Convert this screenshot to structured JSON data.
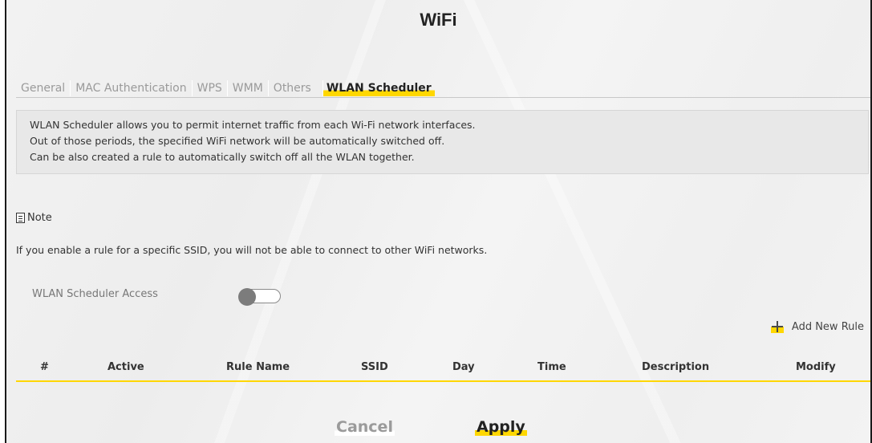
{
  "header": {
    "title": "WiFi"
  },
  "tabs": [
    {
      "label": "General"
    },
    {
      "label": "MAC Authentication"
    },
    {
      "label": "WPS"
    },
    {
      "label": "WMM"
    },
    {
      "label": "Others"
    },
    {
      "label": "WLAN Scheduler",
      "active": true
    }
  ],
  "description": {
    "line1": "WLAN Scheduler allows you to permit internet traffic from each Wi-Fi network interfaces.",
    "line2": "Out of those periods, the specified WiFi network will be automatically switched off.",
    "line3": "Can be also created a rule to automatically switch off all the WLAN together."
  },
  "note": {
    "heading": "Note",
    "text": "If you enable a rule for a specific SSID, you will not be able to connect to other WiFi networks."
  },
  "access": {
    "label": "WLAN Scheduler Access",
    "enabled": false
  },
  "add_rule": {
    "label": "Add New Rule",
    "icon": "plus-icon"
  },
  "table": {
    "columns": [
      "#",
      "Active",
      "Rule Name",
      "SSID",
      "Day",
      "Time",
      "Description",
      "Modify"
    ],
    "rows": []
  },
  "buttons": {
    "cancel": "Cancel",
    "apply": "Apply"
  },
  "colors": {
    "accent": "#ffd700",
    "frame_border": "#1a1a1a",
    "panel_bg": "#f0f0f0"
  }
}
